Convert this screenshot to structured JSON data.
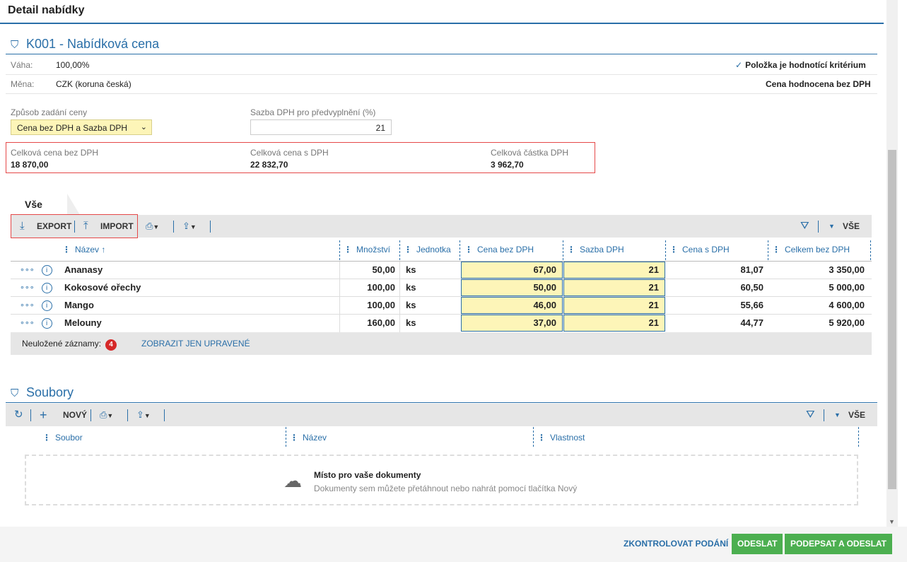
{
  "header": {
    "title": "Detail nabídky"
  },
  "section1": {
    "title": "K001 - Nabídková cena",
    "vaha_label": "Váha:",
    "vaha_value": "100,00%",
    "mena_label": "Měna:",
    "mena_value": "CZK (koruna česká)",
    "criterion": "Položka je hodnotící kritérium",
    "evaluation": "Cena hodnocena bez DPH",
    "zpusob_label": "Způsob zadání ceny",
    "zpusob_value": "Cena bez DPH a Sazba DPH",
    "sazba_label": "Sazba DPH pro předvyplnění (%)",
    "sazba_value": "21",
    "total_bez_label": "Celková cena bez DPH",
    "total_bez_value": "18 870,00",
    "total_s_label": "Celková cena s DPH",
    "total_s_value": "22 832,70",
    "total_dph_label": "Celková částka DPH",
    "total_dph_value": "3 962,70"
  },
  "grid": {
    "tab": "Vše",
    "export": "EXPORT",
    "import": "IMPORT",
    "filter_all": "VŠE",
    "columns": [
      "Název",
      "Množství",
      "Jednotka",
      "Cena bez DPH",
      "Sazba DPH",
      "Cena s DPH",
      "Celkem bez DPH"
    ],
    "rows": [
      [
        "Ananasy",
        "50,00",
        "ks",
        "67,00",
        "21",
        "81,07",
        "3 350,00"
      ],
      [
        "Kokosové ořechy",
        "100,00",
        "ks",
        "50,00",
        "21",
        "60,50",
        "5 000,00"
      ],
      [
        "Mango",
        "100,00",
        "ks",
        "46,00",
        "21",
        "55,66",
        "4 600,00"
      ],
      [
        "Melouny",
        "160,00",
        "ks",
        "37,00",
        "21",
        "44,77",
        "5 920,00"
      ]
    ],
    "unsaved_label": "Neuložené záznamy:",
    "unsaved_count": "4",
    "show_modified": "ZOBRAZIT JEN UPRAVENÉ"
  },
  "files": {
    "title": "Soubory",
    "new_label": "NOVÝ",
    "filter_all": "VŠE",
    "columns": [
      "Soubor",
      "Název",
      "Vlastnost"
    ],
    "drop_title": "Místo pro vaše dokumenty",
    "drop_sub": "Dokumenty sem můžete přetáhnout nebo nahrát pomocí tlačítka Nový"
  },
  "actions": {
    "check": "ZKONTROLOVAT PODÁNÍ",
    "send": "ODESLAT",
    "sign_send": "PODEPSAT A ODESLAT"
  },
  "colors": {
    "accent": "#2a6fa8",
    "edit_bg": "#fdf5b8",
    "green": "#4caf50",
    "red": "#d62828"
  }
}
